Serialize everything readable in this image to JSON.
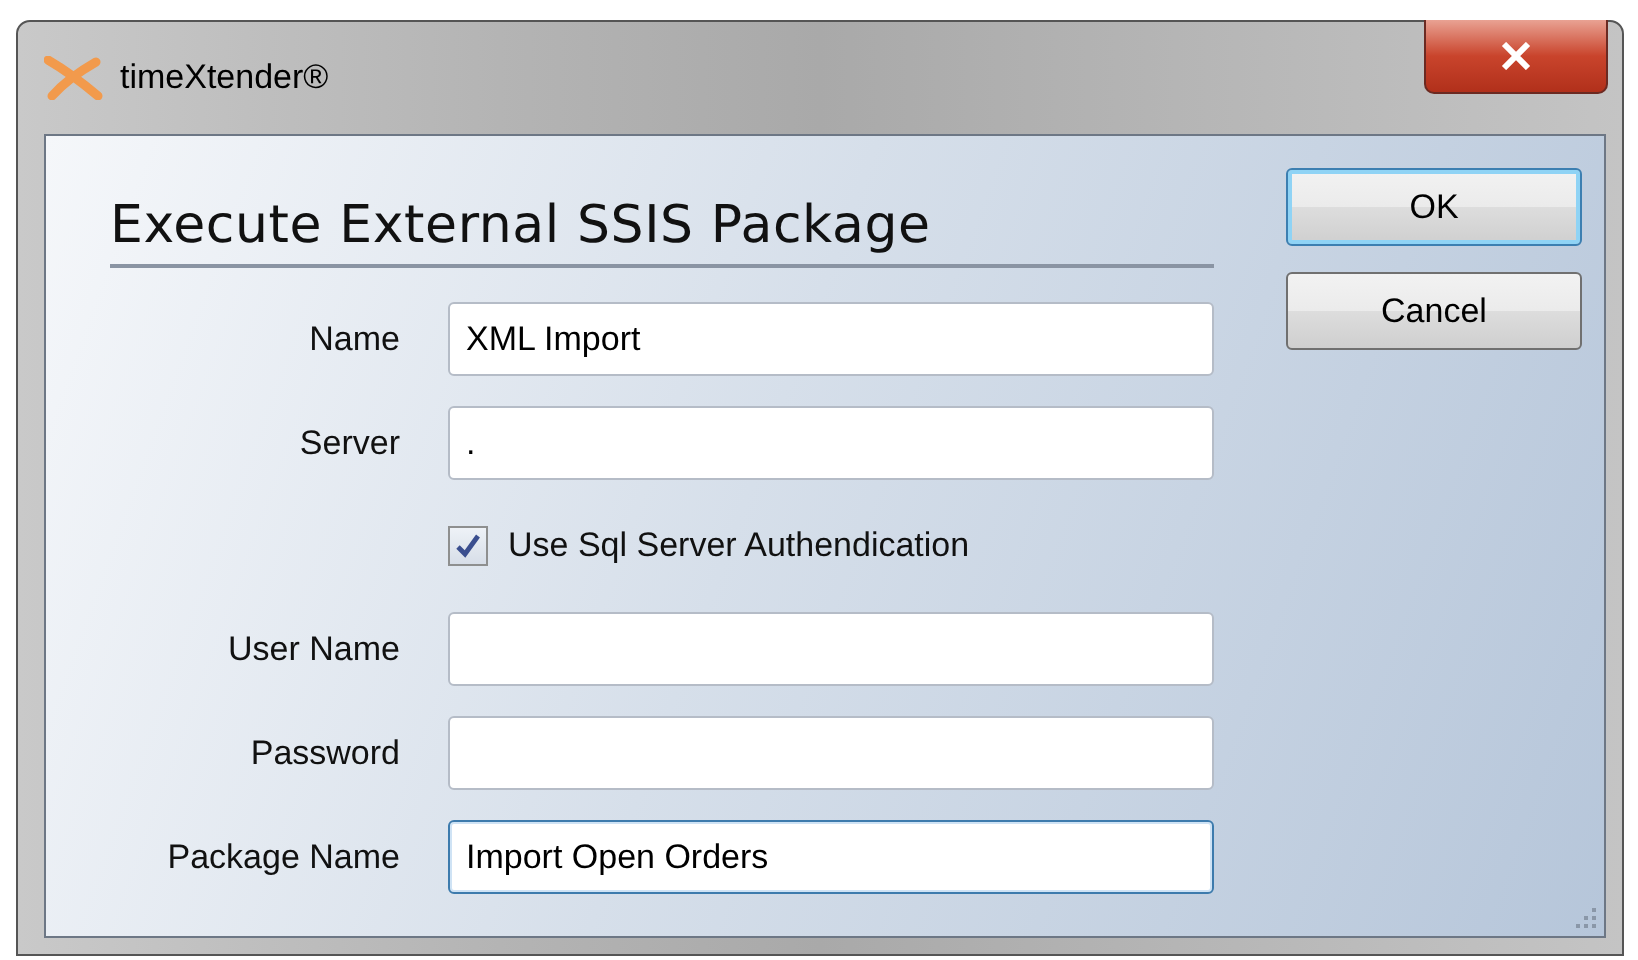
{
  "window": {
    "title": "timeXtender®"
  },
  "heading": "Execute External SSIS Package",
  "buttons": [
    {
      "label": "OK",
      "default": true
    },
    {
      "label": "Cancel",
      "default": false
    }
  ],
  "rows": [
    {
      "kind": "text",
      "label": "Name",
      "value": "XML Import",
      "focused": false
    },
    {
      "kind": "text",
      "label": "Server",
      "value": ".",
      "focused": false
    },
    {
      "kind": "checkbox",
      "label": "Use Sql Server Authendication",
      "checked": true
    },
    {
      "kind": "text",
      "label": "User Name",
      "value": "",
      "focused": false
    },
    {
      "kind": "text",
      "label": "Password",
      "value": "",
      "focused": false
    },
    {
      "kind": "text",
      "label": "Package Name",
      "value": "Import Open Orders",
      "focused": true
    }
  ]
}
